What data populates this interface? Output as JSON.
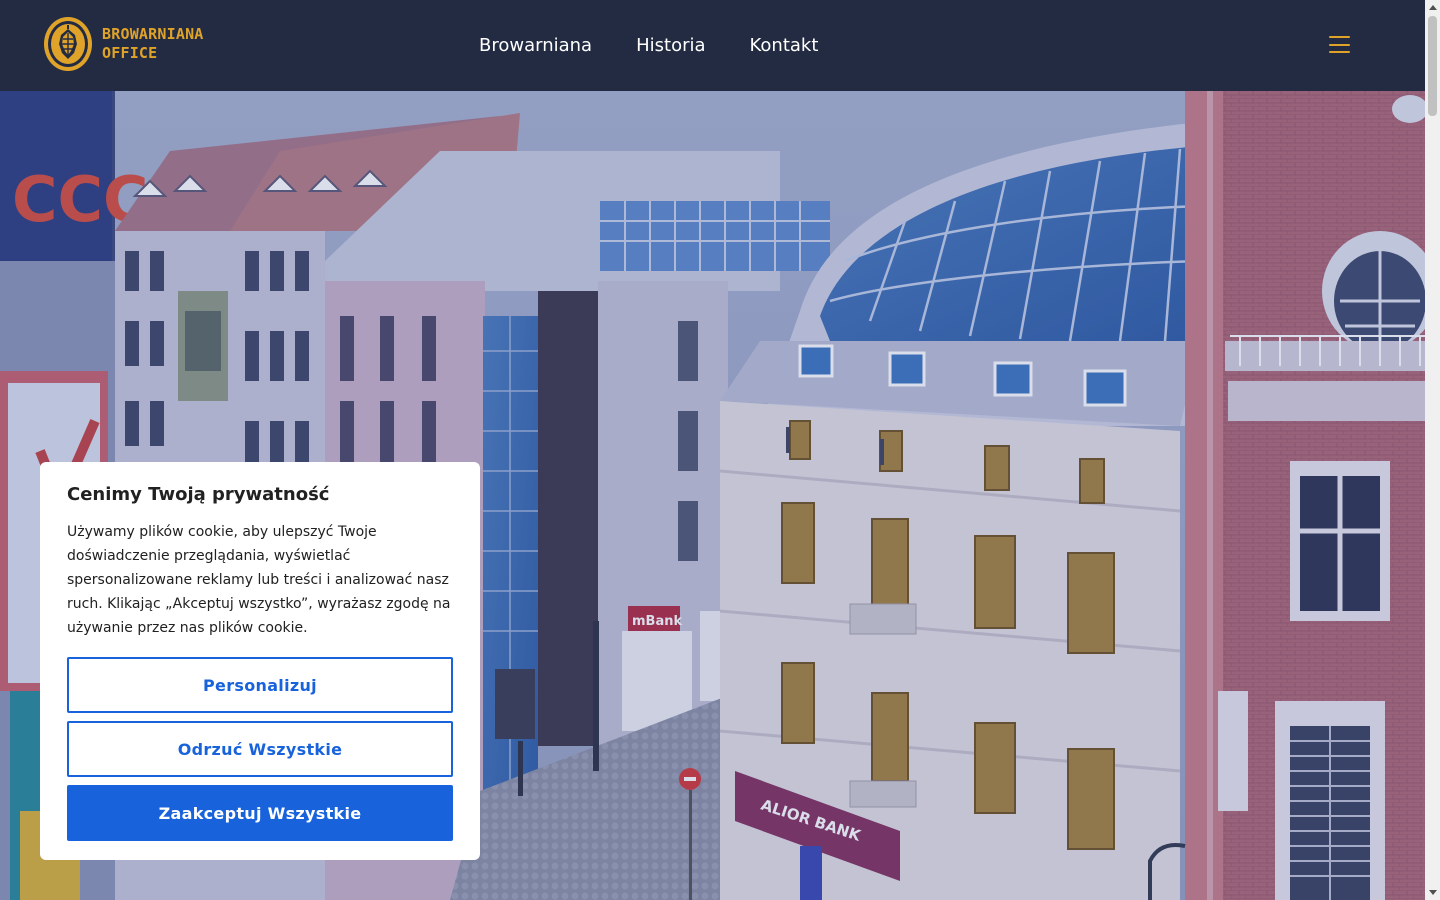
{
  "header": {
    "logo_line1": "BROWARNIANA",
    "logo_line2": "OFFICE",
    "nav": [
      {
        "label": "Browarniana"
      },
      {
        "label": "Historia"
      },
      {
        "label": "Kontakt"
      }
    ]
  },
  "hero": {
    "sign_ccc": "CCC",
    "sign_mbank": "mBank",
    "sign_alior": "ALIOR BANK"
  },
  "cookie": {
    "title": "Cenimy Twoją prywatność",
    "body": "Używamy plików cookie, aby ulepszyć Twoje doświadczenie przeglądania, wyświetlać spersonalizowane reklamy lub treści i analizować nasz ruch. Klikając „Akceptuj wszystko”, wyrażasz zgodę na używanie przez nas plików cookie.",
    "customize_label": "Personalizuj",
    "reject_label": "Odrzuć Wszystkie",
    "accept_label": "Zaakceptuj Wszystkie"
  },
  "colors": {
    "header_bg": "#232b42",
    "accent": "#e0a329",
    "primary_button": "#1863dc"
  }
}
